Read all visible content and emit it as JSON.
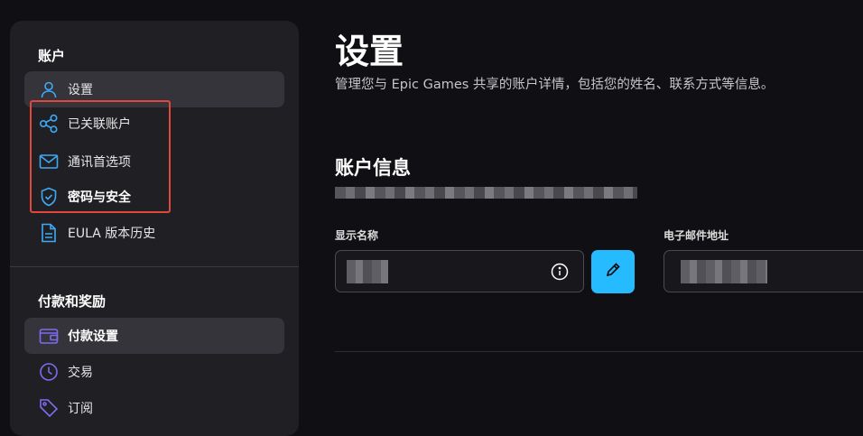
{
  "sidebar": {
    "account_section": "账户",
    "account_items": [
      {
        "label": "设置",
        "icon": "user-icon"
      },
      {
        "label": "已关联账户",
        "icon": "share-icon"
      },
      {
        "label": "通讯首选项",
        "icon": "mail-icon"
      },
      {
        "label": "密码与安全",
        "icon": "shield-icon"
      },
      {
        "label": "EULA 版本历史",
        "icon": "document-icon"
      }
    ],
    "payment_section": "付款和奖励",
    "payment_items": [
      {
        "label": "付款设置",
        "icon": "wallet-icon"
      },
      {
        "label": "交易",
        "icon": "clock-icon"
      },
      {
        "label": "订阅",
        "icon": "tag-icon"
      }
    ]
  },
  "main": {
    "title": "设置",
    "description": "管理您与 Epic Games 共享的账户详情，包括您的姓名、联系方式等信息。",
    "account_info_title": "账户信息",
    "display_name_label": "显示名称",
    "email_label": "电子邮件地址"
  },
  "colors": {
    "accent": "#26bbff",
    "highlight_border": "#e2473b",
    "icon_blue": "#3fa9f5",
    "icon_purple": "#7c6cf0"
  }
}
